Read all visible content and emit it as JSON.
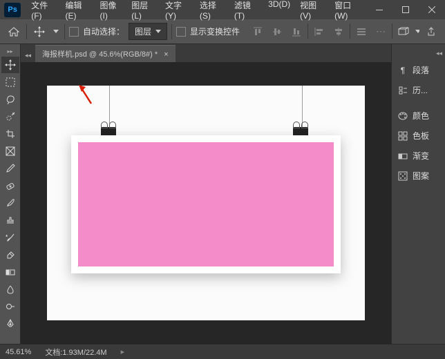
{
  "menu": {
    "file": "文件(F)",
    "edit": "编辑(E)",
    "image": "图像(I)",
    "layer": "图层(L)",
    "type": "文字(Y)",
    "select": "选择(S)",
    "filter": "滤镜(T)",
    "three_d": "3D(D)",
    "view": "视图(V)",
    "window": "窗口(W)"
  },
  "options": {
    "autoSelect": "自动选择：",
    "target": "图层",
    "showTransform": "显示变换控件"
  },
  "tab": {
    "title": "海报样机.psd @ 45.6%(RGB/8#) *",
    "close": "×"
  },
  "panels": {
    "paragraph": "段落",
    "history": "历...",
    "color": "颜色",
    "swatches": "色板",
    "gradient": "渐变",
    "patterns": "图案"
  },
  "status": {
    "zoom": "45.61%",
    "docLabel": "文档:",
    "docValue": "1.93M/22.4M"
  },
  "colors": {
    "poster": "#f48cc9",
    "canvas": "#fbfbfb",
    "bg": "#262626",
    "arrow": "#d81e06"
  }
}
